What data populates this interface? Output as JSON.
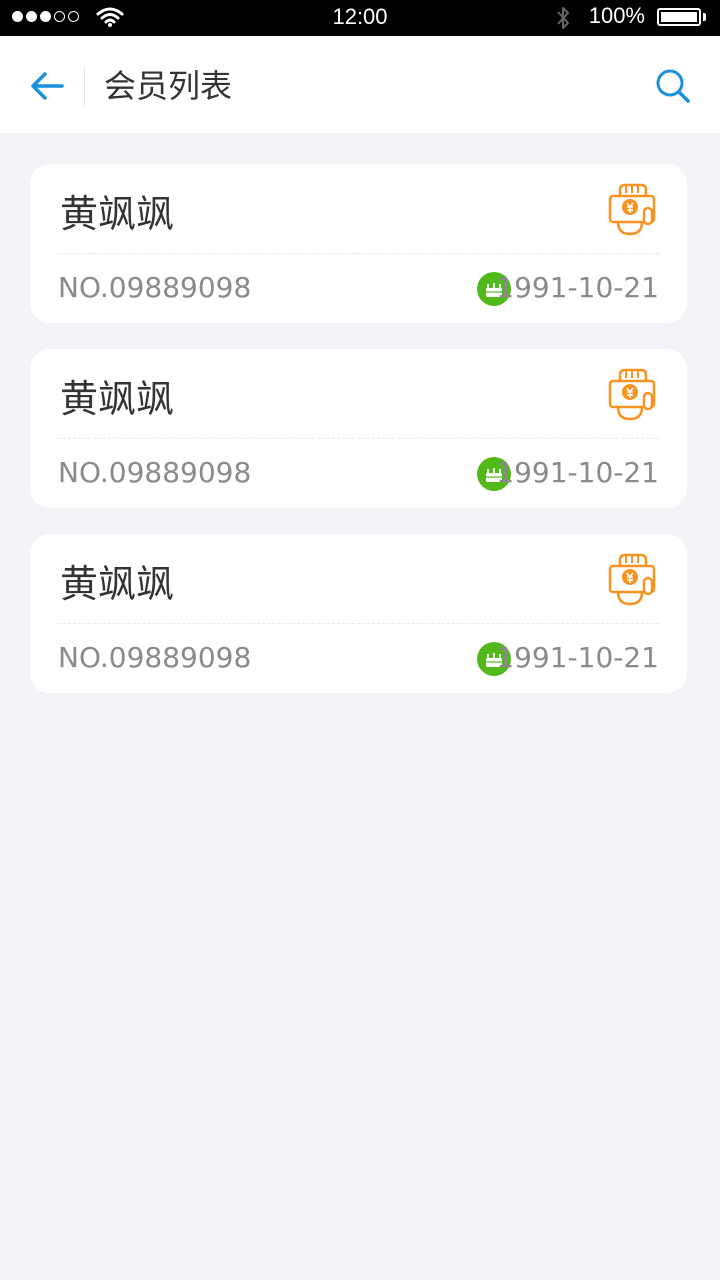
{
  "status_bar": {
    "time": "12:00",
    "battery_percent": "100%",
    "signal_bars_filled": 3,
    "signal_bars_total": 5
  },
  "nav": {
    "title": "会员列表",
    "back_icon": "arrow-left-icon",
    "search_icon": "search-icon"
  },
  "colors": {
    "accent": "#1a8fdd",
    "vip_orange": "#f7931e",
    "birthday_green": "#52b91a",
    "text_dark": "#333333",
    "text_gray": "#8a8a8a",
    "background": "#f3f4f8"
  },
  "members": [
    {
      "name": "黄飒飒",
      "number": "NO.09889098",
      "birthday": "1991-10-21"
    },
    {
      "name": "黄飒飒",
      "number": "NO.09889098",
      "birthday": "1991-10-21"
    },
    {
      "name": "黄飒飒",
      "number": "NO.09889098",
      "birthday": "1991-10-21"
    }
  ]
}
